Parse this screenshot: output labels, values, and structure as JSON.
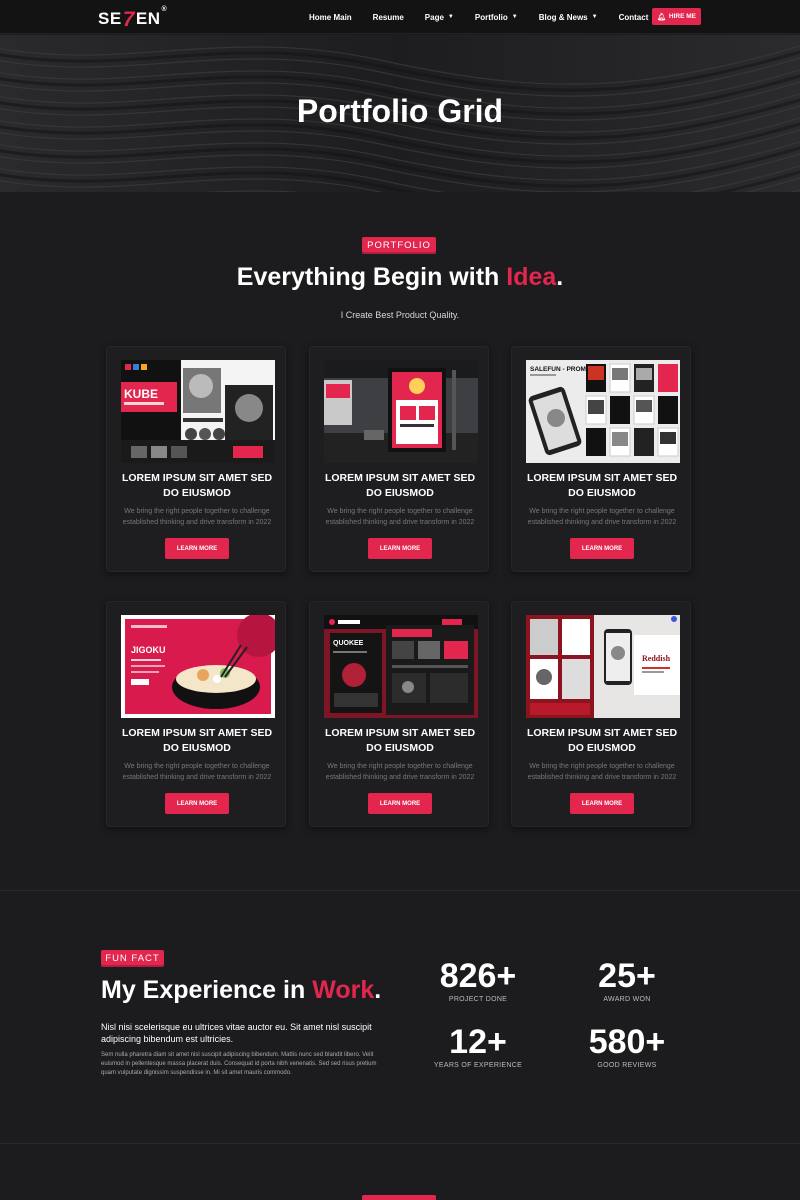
{
  "nav": {
    "logo_prefix": "SE",
    "logo_seven": "7",
    "logo_suffix": "EN",
    "logo_mark": "®",
    "items": [
      {
        "label": "Home Main",
        "caret": false
      },
      {
        "label": "Resume",
        "caret": false
      },
      {
        "label": "Page",
        "caret": true
      },
      {
        "label": "Portfolio",
        "caret": true
      },
      {
        "label": "Blog & News",
        "caret": true
      },
      {
        "label": "Contact",
        "caret": false
      }
    ],
    "hire_label": "HIRE ME",
    "hire_icon": "bell-icon"
  },
  "hero": {
    "title": "Portfolio Grid"
  },
  "portfolio": {
    "badge": "PORTFOLIO",
    "title_start": "Everything Begin with ",
    "title_accent": "Idea",
    "title_end": ".",
    "subtitle": "I Create Best Product Quality.",
    "cards": [
      {
        "title": "LOREM IPSUM SIT AMET SED DO EIUSMOD",
        "desc": "We bring the right people together to challenge established thinking and drive transform in 2022",
        "button": "LEARN MORE",
        "thumb_text": "KUBE"
      },
      {
        "title": "LOREM IPSUM SIT AMET SED DO EIUSMOD",
        "desc": "We bring the right people together to challenge established thinking and drive transform in 2022",
        "button": "LEARN MORE",
        "thumb_text": ""
      },
      {
        "title": "LOREM IPSUM SIT AMET SED DO EIUSMOD",
        "desc": "We bring the right people together to challenge established thinking and drive transform in 2022",
        "button": "LEARN MORE",
        "thumb_text": "SALEFUN - PROMO"
      },
      {
        "title": "LOREM IPSUM SIT AMET SED DO EIUSMOD",
        "desc": "We bring the right people together to challenge established thinking and drive transform in 2022",
        "button": "LEARN MORE",
        "thumb_text": "JIGOKU"
      },
      {
        "title": "LOREM IPSUM SIT AMET SED DO EIUSMOD",
        "desc": "We bring the right people together to challenge established thinking and drive transform in 2022",
        "button": "LEARN MORE",
        "thumb_text": "QUOKEE"
      },
      {
        "title": "LOREM IPSUM SIT AMET SED DO EIUSMOD",
        "desc": "We bring the right people together to challenge established thinking and drive transform in 2022",
        "button": "LEARN MORE",
        "thumb_text": "Reddish"
      }
    ]
  },
  "funfact": {
    "badge": "FUN FACT",
    "title_start": "My Experience in ",
    "title_accent": "Work",
    "title_end": ".",
    "lead": "Nisl nisi scelerisque eu ultrices vitae auctor eu. Sit amet nisl suscipit adipiscing bibendum est ultricies.",
    "body": "Sem nulla pharetra diam sit amet nisl suscipit adipiscing bibendum. Mattis nunc sed blandit libero. Velit euismod in pellentesque massa placerat duis. Consequat id porta nibh venenatis. Sed sed risus pretium quam vulputate dignissim suspendisse in. Mi sit amet mauris commodo.",
    "stats": [
      {
        "num": "826+",
        "label": "PROJECT DONE"
      },
      {
        "num": "25+",
        "label": "AWARD WON"
      },
      {
        "num": "12+",
        "label": "YEARS OF EXPERIENCE"
      },
      {
        "num": "580+",
        "label": "GOOD REVIEWS"
      }
    ]
  },
  "colors": {
    "accent": "#e2264d",
    "background": "#1c1c1e",
    "card": "#1e1e20"
  }
}
